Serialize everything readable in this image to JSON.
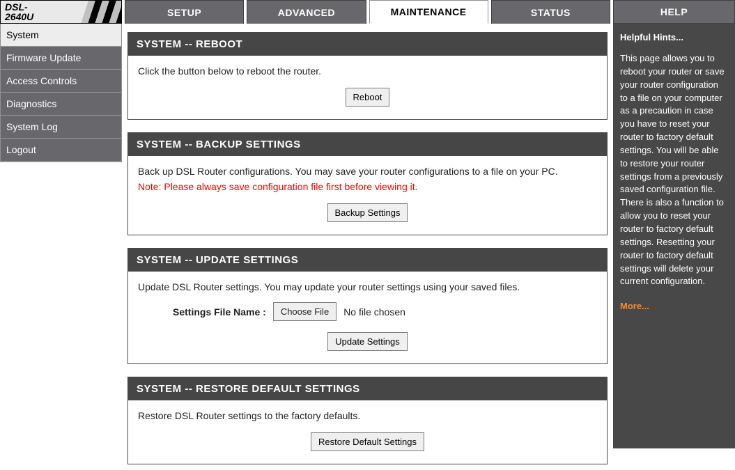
{
  "logo": {
    "line1": "DSL-",
    "line2": "2640U"
  },
  "sidebar": {
    "items": [
      {
        "label": "System",
        "active": true
      },
      {
        "label": "Firmware Update",
        "active": false
      },
      {
        "label": "Access Controls",
        "active": false
      },
      {
        "label": "Diagnostics",
        "active": false
      },
      {
        "label": "System Log",
        "active": false
      },
      {
        "label": "Logout",
        "active": false
      }
    ]
  },
  "tabs": [
    {
      "label": "SETUP",
      "active": false
    },
    {
      "label": "ADVANCED",
      "active": false
    },
    {
      "label": "MAINTENANCE",
      "active": true
    },
    {
      "label": "STATUS",
      "active": false
    }
  ],
  "help_tab": "HELP",
  "panels": {
    "reboot": {
      "title": "SYSTEM -- REBOOT",
      "text": "Click the button below to reboot the router.",
      "button": "Reboot"
    },
    "backup": {
      "title": "SYSTEM -- BACKUP SETTINGS",
      "text": "Back up DSL Router configurations. You may save your router configurations to a file on your PC.",
      "note": "Note: Please always save configuration file first before viewing it.",
      "button": "Backup Settings"
    },
    "update": {
      "title": "SYSTEM -- UPDATE SETTINGS",
      "text": "Update DSL Router settings. You may update your router settings using your saved files.",
      "file_label": "Settings File Name :",
      "choose_button": "Choose File",
      "file_status": "No file chosen",
      "button": "Update Settings"
    },
    "restore": {
      "title": "SYSTEM -- RESTORE DEFAULT SETTINGS",
      "text": "Restore DSL Router settings to the factory defaults.",
      "button": "Restore Default Settings"
    }
  },
  "help": {
    "title": "Helpful Hints...",
    "text": "This page allows you to reboot your router or save your router configuration to a file on your computer as a precaution in case you have to reset your router to factory default settings. You will be able to restore your router settings from a previously saved configuration file. There is also a function to allow you to reset your router to factory default settings. Resetting your router to factory default settings will delete your current configuration.",
    "more": "More..."
  }
}
